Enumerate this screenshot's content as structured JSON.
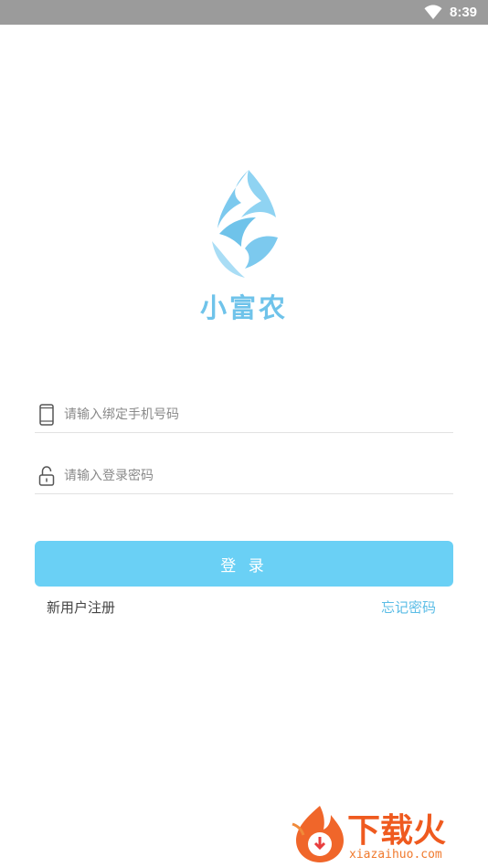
{
  "status_bar": {
    "time": "8:39",
    "wifi_icon": "wifi-icon"
  },
  "logo": {
    "text": "小富农",
    "color": "#6fc3ea"
  },
  "form": {
    "phone": {
      "placeholder": "请输入绑定手机号码",
      "icon": "phone-icon",
      "value": ""
    },
    "password": {
      "placeholder": "请输入登录密码",
      "icon": "lock-icon",
      "value": ""
    },
    "login_label": "登 录",
    "register_label": "新用户注册",
    "forgot_label": "忘记密码"
  },
  "watermark": {
    "title": "下载火",
    "url": "xiazaihuo.com"
  },
  "colors": {
    "accent": "#6ad0f5",
    "link": "#5bbde6",
    "status_bar": "#9b9b9b"
  }
}
